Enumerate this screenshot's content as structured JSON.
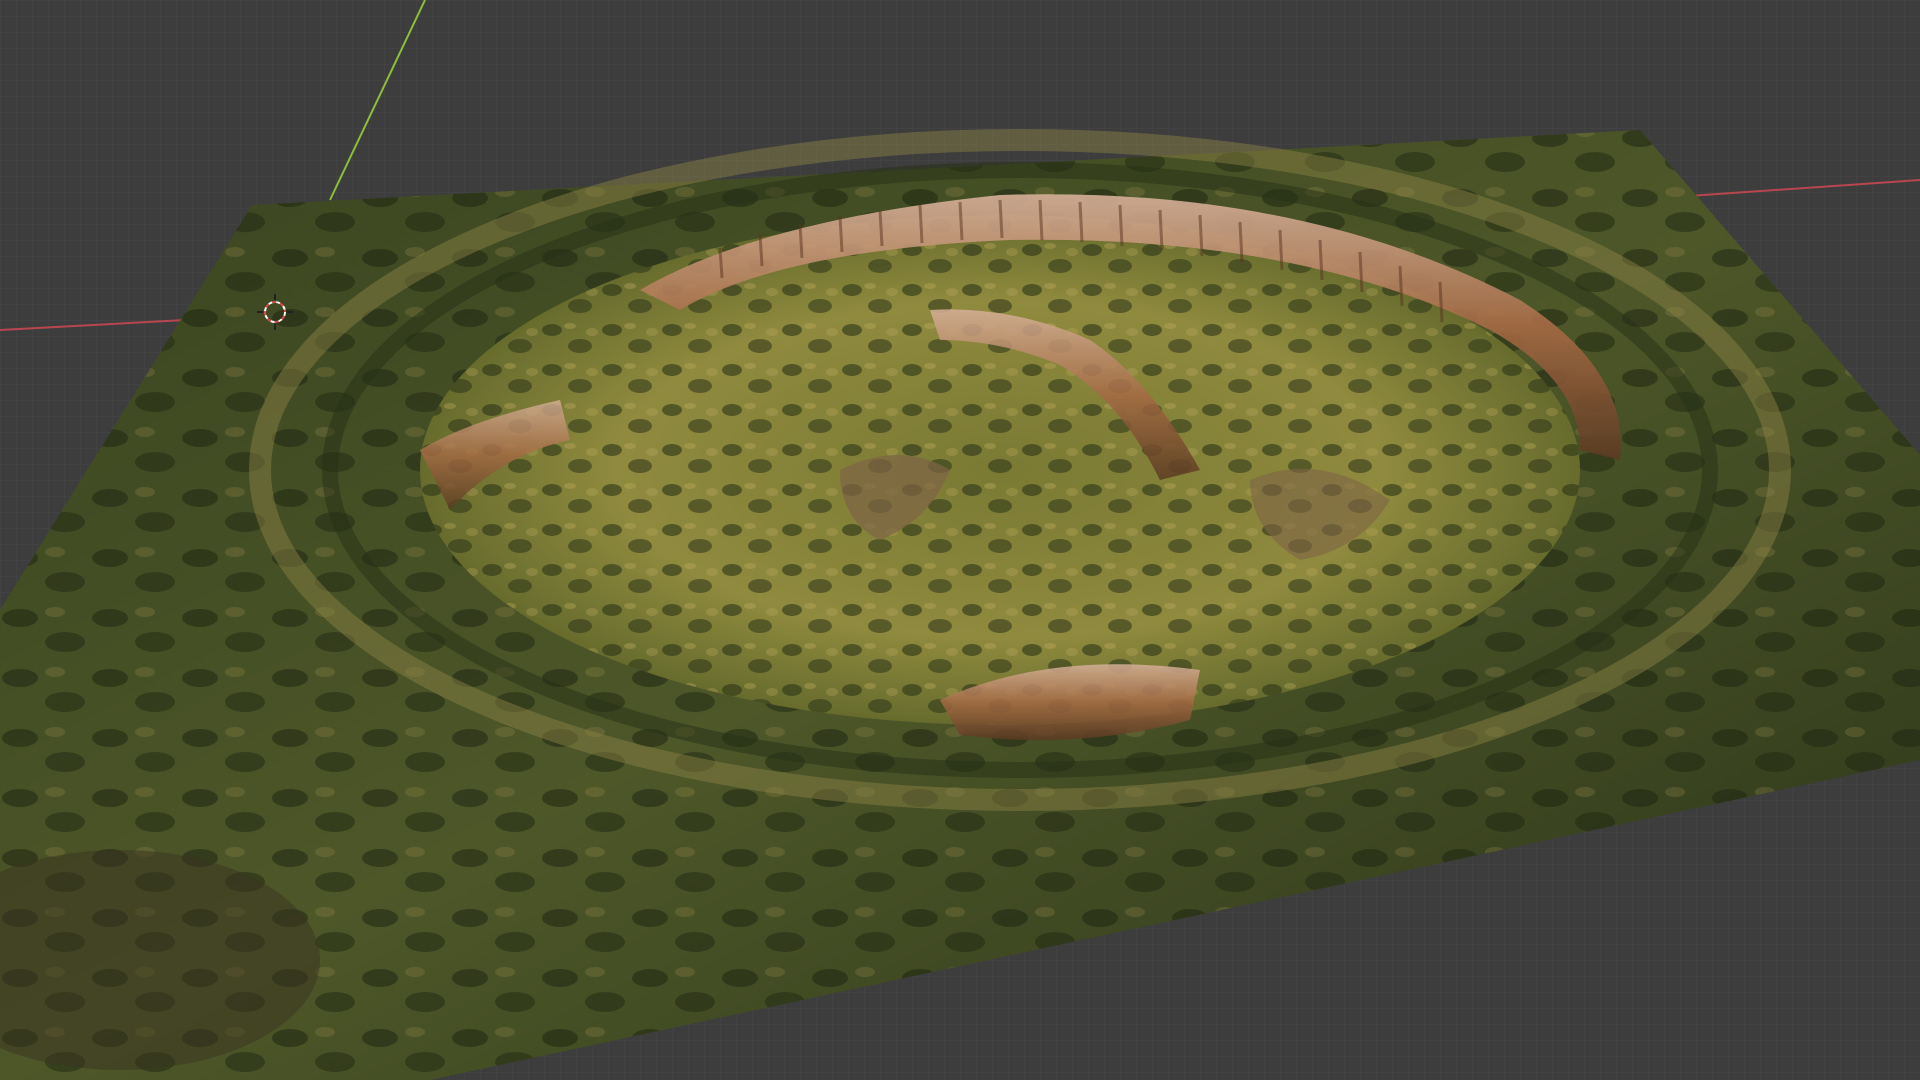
{
  "viewport": {
    "kind": "3d-viewport",
    "shading": "material-preview",
    "background_color": "#3d3d3d",
    "grid_color": "#4a4a4a",
    "x_axis_color": "#b8464e",
    "y_axis_color": "#8cbf3a",
    "scene_object": "terrain-plane",
    "terrain_colors": {
      "grass_dark": "#2a3318",
      "grass_mid": "#4e5a26",
      "sand": "#b3a25c",
      "rock": "#9a6a48",
      "cliff": "#c9a48a"
    },
    "cursor_color": "#d94a4a"
  }
}
